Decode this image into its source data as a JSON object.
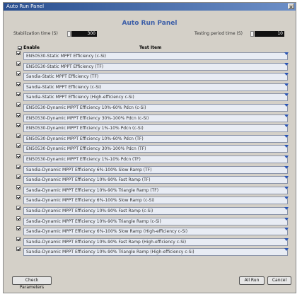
{
  "window": {
    "title": "Auto Run Panel",
    "close_glyph": "×"
  },
  "panel": {
    "heading": "Auto Run Panel"
  },
  "stabilization": {
    "label": "Stabilization time (S)",
    "value": "300"
  },
  "testing": {
    "label": "Testing period time (S)",
    "value": "10"
  },
  "columns": {
    "enable": "Enable",
    "test_item": "Test Item"
  },
  "tests": [
    "EN50530-Static MPPT Efficiency (c-Si)",
    "EN50530-Static MPPT Efficiency (TF)",
    "Sandia-Static MPPT Efficiency (TF)",
    "Sandia-Static MPPT Efficiency (c-Si)",
    "Sandia-Static MPPT Efficiency (High-efficiency c-Si)",
    "EN50530-Dynamic MPPT Efficiency 10%-60% Pdcn (c-Si)",
    "EN50530-Dynamic MPPT Efficiency 30%-100% Pdcn (c-Si)",
    "EN50530-Dynamic MPPT Efficiency 1%-10% Pdcn (c-Si)",
    "EN50530-Dynamic MPPT Efficiency 10%-60% Pdcn (TF)",
    "EN50530-Dynamic MPPT Efficiency 30%-100% Pdcn (TF)",
    "EN50530-Dynamic MPPT Efficiency 1%-10% Pdcn (TF)",
    "Sandia-Dynamic MPPT Efficiency 6%-100% Slow Ramp (TF)",
    "Sandia-Dynamic MPPT Efficiency 10%-90% Fast Ramp (TF)",
    "Sandia-Dynamic MPPT Efficiency 10%-90% Triangle Ramp (TF)",
    "Sandia-Dynamic MPPT Efficiency 6%-100% Slow Ramp (c-Si)",
    "Sandia-Dynamic MPPT Efficiency 10%-90% Fast Ramp (c-Si)",
    "Sandia-Dynamic MPPT Efficiency 10%-90% Triangle Ramp (c-Si)",
    "Sandia-Dynamic MPPT Efficiency 6%-100% Slow Ramp (High-efficiency c-Si)",
    "Sandia-Dynamic MPPT Efficiency 10%-90% Fast Ramp (High-efficiency c-Si)",
    "Sandia-Dynamic MPPT Efficiency 10%-90% Triangle Ramp (High-efficiency c-Si)"
  ],
  "buttons": {
    "check": "Check Parameters",
    "run": "All Run",
    "cancel": "Cancel"
  },
  "colors": {
    "accent": "#3d5fa8",
    "arrow": "#2a55b5",
    "title_bar": "#2a4f8f"
  }
}
